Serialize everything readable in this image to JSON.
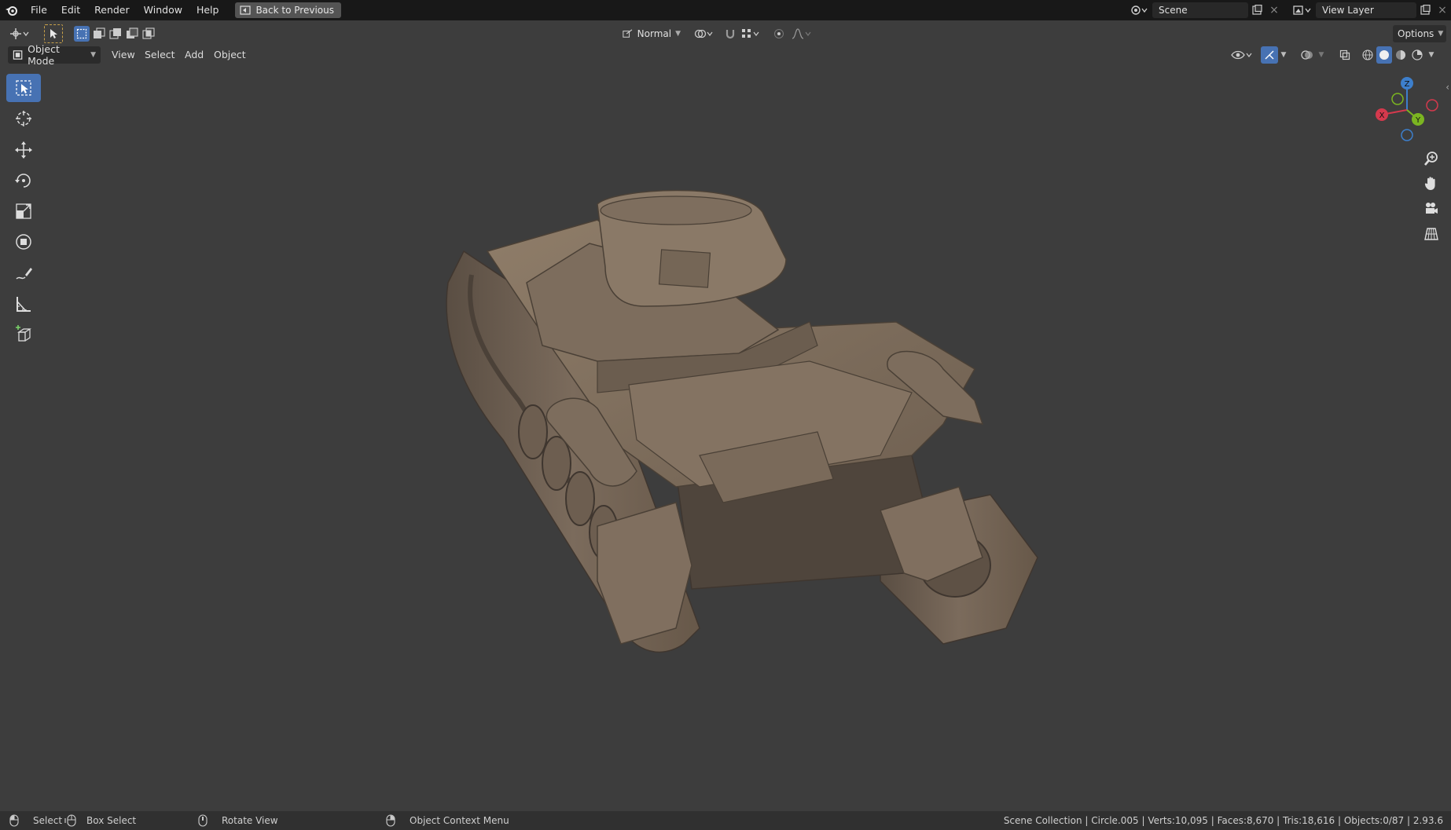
{
  "topbar": {
    "menus": [
      "File",
      "Edit",
      "Render",
      "Window",
      "Help"
    ],
    "back_button": "Back to Previous",
    "scene": "Scene",
    "view_layer": "View Layer"
  },
  "toolheader": {
    "orientation": "Normal",
    "options": "Options"
  },
  "viewport_header": {
    "mode": "Object Mode",
    "menus": [
      "View",
      "Select",
      "Add",
      "Object"
    ]
  },
  "gizmo": {
    "x": "X",
    "y": "Y",
    "z": "Z"
  },
  "statusbar": {
    "select": "Select",
    "box_select": "Box Select",
    "rotate_view": "Rotate View",
    "context_menu": "Object Context Menu",
    "stats": "Scene Collection | Circle.005 | Verts:10,095 | Faces:8,670 | Tris:18,616 | Objects:0/87 | 2.93.6"
  },
  "colors": {
    "accent": "#4772b3",
    "viewport_bg": "#3d3d3d",
    "topbar_bg": "#181818",
    "model": "#7a6a5a",
    "axis_x": "#d4394d",
    "axis_y": "#7bb521",
    "axis_z": "#3d7fcc"
  },
  "icons": [
    "blender-logo-icon",
    "select-box-icon",
    "cursor-icon",
    "move-icon",
    "rotate-icon",
    "scale-icon",
    "transform-icon",
    "annotate-icon",
    "measure-icon",
    "add-cube-icon",
    "zoom-icon",
    "hand-pan-icon",
    "camera-icon",
    "grid-ortho-icon"
  ]
}
